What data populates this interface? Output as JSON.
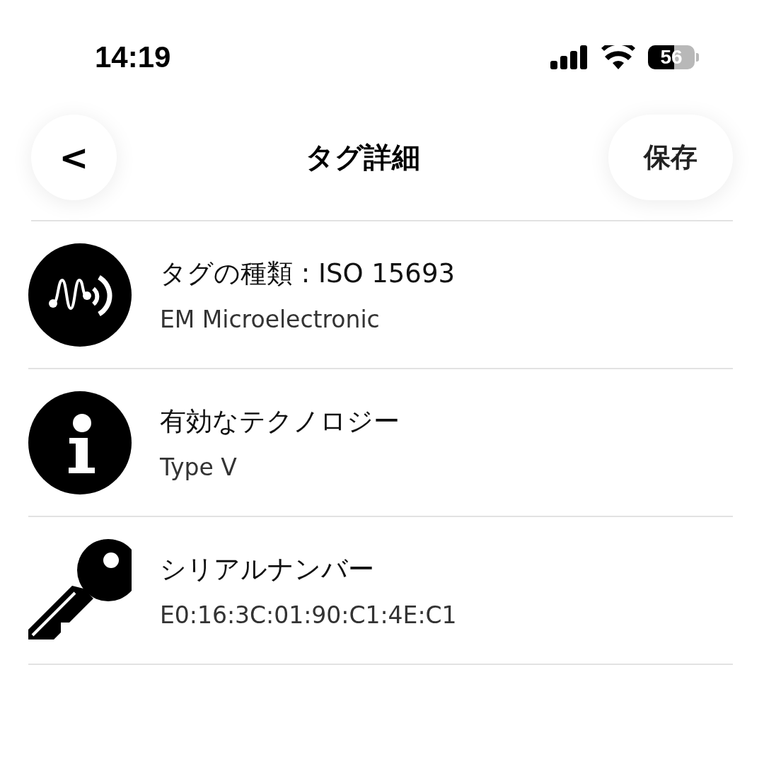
{
  "status_bar": {
    "time": "14:19",
    "battery": "56"
  },
  "nav": {
    "back": "<",
    "title": "タグ詳細",
    "save": "保存"
  },
  "rows": [
    {
      "kind": "nfc",
      "title": "タグの種類 : ISO 15693",
      "subtitle": "EM Microelectronic"
    },
    {
      "kind": "info",
      "title": "有効なテクノロジー",
      "subtitle": "Type V"
    },
    {
      "kind": "key",
      "title": "シリアルナンバー",
      "subtitle": "E0:16:3C:01:90:C1:4E:C1"
    }
  ]
}
